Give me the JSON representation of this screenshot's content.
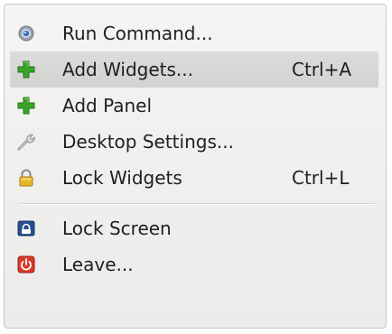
{
  "menu": {
    "items": [
      {
        "label": "Run Command...",
        "shortcut": "",
        "icon": "run-command-icon"
      },
      {
        "label": "Add Widgets...",
        "shortcut": "Ctrl+A",
        "icon": "add-icon"
      },
      {
        "label": "Add Panel",
        "shortcut": "",
        "icon": "add-icon"
      },
      {
        "label": "Desktop Settings...",
        "shortcut": "",
        "icon": "wrench-icon"
      },
      {
        "label": "Lock Widgets",
        "shortcut": "Ctrl+L",
        "icon": "padlock-icon"
      },
      {
        "label": "Lock Screen",
        "shortcut": "",
        "icon": "lock-screen-icon"
      },
      {
        "label": "Leave...",
        "shortcut": "",
        "icon": "power-icon"
      }
    ],
    "highlighted_item": "Add Widgets..."
  },
  "colors": {
    "menu_background": "#efeeed",
    "highlight": "#d6d5d3",
    "green_plus": "#3aa428",
    "power_red": "#d83a2a",
    "lock_blue": "#27508f",
    "padlock_gold": "#e8b626"
  }
}
